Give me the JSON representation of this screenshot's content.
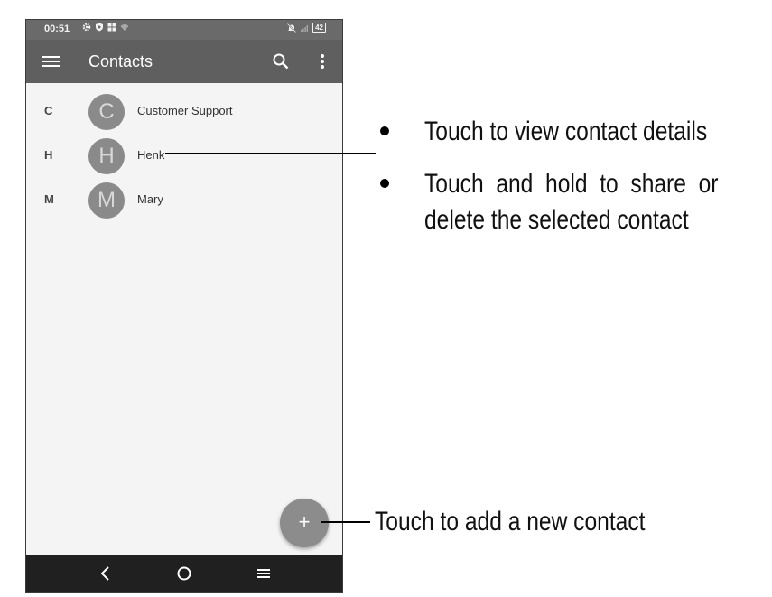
{
  "status_bar": {
    "time": "00:51",
    "left_icons": [
      "settings-icon",
      "shield-icon",
      "grid-icon",
      "wifi-icon"
    ],
    "right_icons": [
      "notifications-off-icon",
      "signal-icon"
    ],
    "battery": "42"
  },
  "app_bar": {
    "title": "Contacts",
    "icons": [
      "menu-icon",
      "search-icon",
      "more-vert-icon"
    ]
  },
  "contacts": [
    {
      "section": "C",
      "initial": "C",
      "name": "Customer Support"
    },
    {
      "section": "H",
      "initial": "H",
      "name": "Henk"
    },
    {
      "section": "M",
      "initial": "M",
      "name": "Mary"
    }
  ],
  "fab": {
    "label": "+"
  },
  "nav_bar": {
    "icons": [
      "back-icon",
      "home-icon",
      "recents-icon"
    ]
  },
  "annotations": {
    "contact_tip_1": "Touch to view contact details",
    "contact_tip_2_line1": "Touch  and  hold  to  share  or",
    "contact_tip_2_line2": "delete the selected contact",
    "fab_tip": "Touch to add a new contact"
  },
  "colors": {
    "app_bar": "#5f5f5f",
    "status_bar": "#6a6a6a",
    "avatar": "#8a8a8a",
    "fab": "#8c8c8c",
    "nav_bar": "#202020",
    "list_background": "#f4f4f4"
  }
}
